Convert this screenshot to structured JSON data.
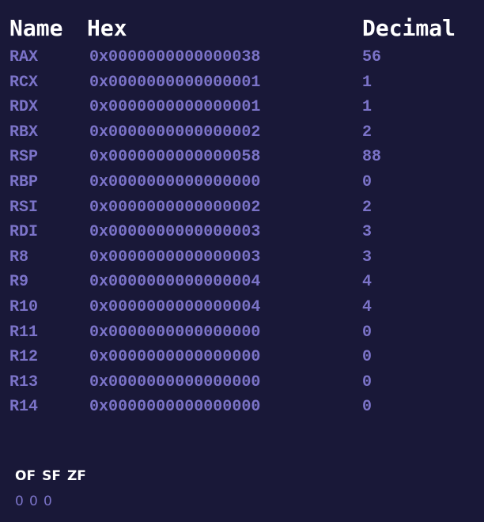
{
  "headers": {
    "name": "Name",
    "hex": "Hex",
    "decimal": "Decimal"
  },
  "registers": [
    {
      "name": "RAX",
      "hex": "0x0000000000000038",
      "decimal": "56"
    },
    {
      "name": "RCX",
      "hex": "0x0000000000000001",
      "decimal": "1"
    },
    {
      "name": "RDX",
      "hex": "0x0000000000000001",
      "decimal": "1"
    },
    {
      "name": "RBX",
      "hex": "0x0000000000000002",
      "decimal": "2"
    },
    {
      "name": "RSP",
      "hex": "0x0000000000000058",
      "decimal": "88"
    },
    {
      "name": "RBP",
      "hex": "0x0000000000000000",
      "decimal": "0"
    },
    {
      "name": "RSI",
      "hex": "0x0000000000000002",
      "decimal": "2"
    },
    {
      "name": "RDI",
      "hex": "0x0000000000000003",
      "decimal": "3"
    },
    {
      "name": "R8",
      "hex": "0x0000000000000003",
      "decimal": "3"
    },
    {
      "name": "R9",
      "hex": "0x0000000000000004",
      "decimal": "4"
    },
    {
      "name": "R10",
      "hex": "0x0000000000000004",
      "decimal": "4"
    },
    {
      "name": "R11",
      "hex": "0x0000000000000000",
      "decimal": "0"
    },
    {
      "name": "R12",
      "hex": "0x0000000000000000",
      "decimal": "0"
    },
    {
      "name": "R13",
      "hex": "0x0000000000000000",
      "decimal": "0"
    },
    {
      "name": "R14",
      "hex": "0x0000000000000000",
      "decimal": "0"
    }
  ],
  "flags": {
    "labels": [
      "OF",
      "SF",
      "ZF"
    ],
    "values": [
      "0",
      "0",
      "0"
    ]
  },
  "colors": {
    "background": "#191838",
    "header_text": "#ffffff",
    "register_text": "#7b73c8"
  }
}
